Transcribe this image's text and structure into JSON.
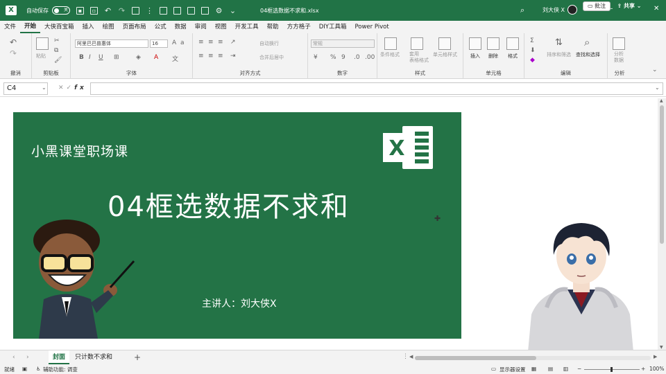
{
  "titlebar": {
    "autosave_label": "自动保存",
    "autosave_state": "关",
    "filename": "04框选数据不求和.xlsx",
    "user_name": "刘大侠 X"
  },
  "menu": {
    "tabs": [
      "文件",
      "开始",
      "大侠百宝箱",
      "插入",
      "绘图",
      "页面布局",
      "公式",
      "数据",
      "审阅",
      "视图",
      "开发工具",
      "帮助",
      "方方格子",
      "DIY工具箱",
      "Power Pivot"
    ],
    "active": "开始",
    "comment_label": "批注",
    "share_label": "共享"
  },
  "ribbon": {
    "groups": {
      "undo": "撤消",
      "clipboard": "剪贴板",
      "font": "字体",
      "align": "对齐方式",
      "number": "数字",
      "styles": "样式",
      "cells": "单元格",
      "editing": "编辑",
      "analysis": "分析"
    },
    "paste_label": "粘贴",
    "font_name": "阿里巴巴普惠体",
    "font_size": "16",
    "wrap_text": "自动换行",
    "merge_center": "合并后居中",
    "number_format": "常规",
    "conditional_format": "条件格式",
    "table_format": "套用\n表格格式",
    "cell_styles": "单元格样式",
    "insert": "插入",
    "delete": "删除",
    "format": "格式",
    "sort_filter": "排序和筛选",
    "find_select": "查找和选择",
    "analyze_data": "分析\n数据"
  },
  "formula_bar": {
    "name_box": "C4",
    "fx": "fx",
    "content": ""
  },
  "slide": {
    "course": "小黑课堂职场课",
    "title": "04框选数据不求和",
    "lecturer": "主讲人：刘大侠X"
  },
  "sheets": {
    "tabs": [
      "封面",
      "只计数不求和"
    ],
    "active": "封面"
  },
  "status": {
    "ready": "就绪",
    "accessibility": "辅助功能: 调查",
    "display_settings": "显示器设置",
    "zoom": "100%"
  },
  "colors": {
    "excel_green": "#217346",
    "slide_green": "#237346"
  }
}
